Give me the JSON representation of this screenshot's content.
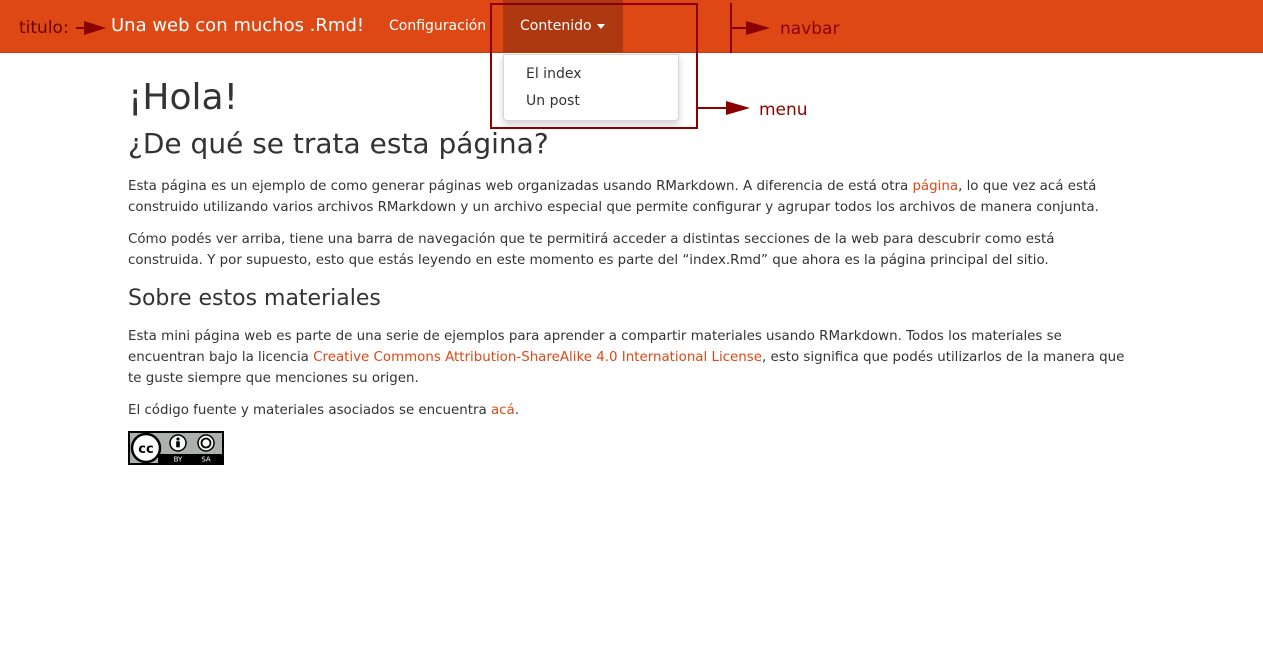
{
  "navbar": {
    "title": "Una web con muchos .Rmd!",
    "items": [
      {
        "label": "Configuración"
      },
      {
        "label": "Contenido"
      }
    ],
    "background": "#dd4814",
    "active_background": "#ae3910"
  },
  "dropdown": {
    "items": [
      {
        "label": "El index"
      },
      {
        "label": "Un post"
      }
    ]
  },
  "annotations": {
    "titulo": "titulo:",
    "navbar": "navbar",
    "menu": "menu",
    "color": "#8b0000"
  },
  "content": {
    "h1": "¡Hola!",
    "h2": "¿De qué se trata esta página?",
    "p1": {
      "before": "Esta página es un ejemplo de como generar páginas web organizadas usando RMarkdown. A diferencia de está otra ",
      "link": "página",
      "after": ", lo que vez acá está construido utilizando varios archivos RMarkdown y un archivo especial que permite configurar y agrupar todos los archivos de manera conjunta."
    },
    "p2": "Cómo podés ver arriba, tiene una barra de navegación que te permitirá acceder a distintas secciones de la web para descubrir como está construida. Y por supuesto, esto que estás leyendo en este momento es parte del “index.Rmd” que ahora es la página principal del sitio.",
    "h3": "Sobre estos materiales",
    "p3": {
      "before": "Esta mini página web es parte de una serie de ejemplos para aprender a compartir materiales usando RMarkdown. Todos los materiales se encuentran bajo la licencia ",
      "link": "Creative Commons Attribution-ShareAlike 4.0 International License",
      "after": ", esto significa que podés utilizarlos de la manera que te guste siempre que menciones su origen."
    },
    "p4": {
      "before": "El código fuente y materiales asociados se encuentra ",
      "link": "acá",
      "after": "."
    },
    "license_badge": {
      "by": "BY",
      "sa": "SA",
      "icon": "cc-by-sa-icon"
    },
    "link_color": "#dd4814"
  }
}
